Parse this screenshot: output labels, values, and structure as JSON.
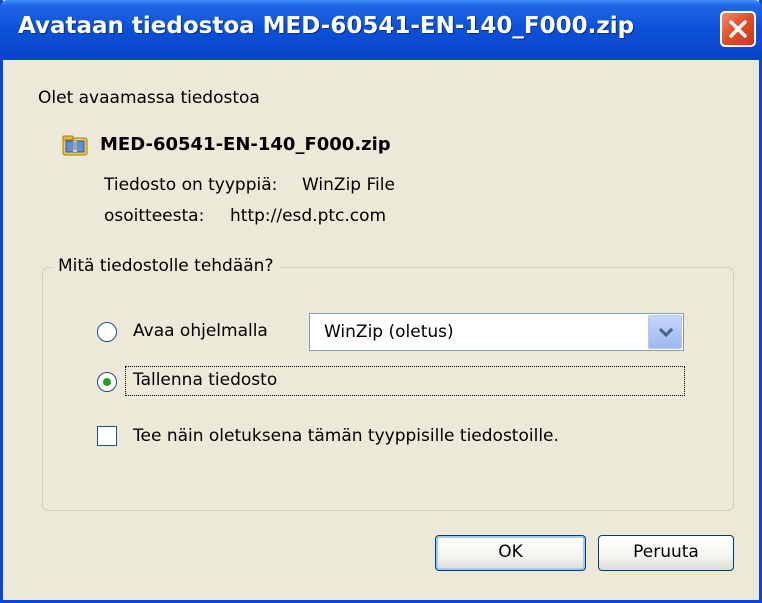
{
  "window": {
    "title": "Avataan tiedostoa MED-60541-EN-140_F000.zip",
    "close_icon": "close-icon"
  },
  "intro_text": "Olet avaamassa tiedostoa",
  "file": {
    "icon": "zip-file-icon",
    "name": "MED-60541-EN-140_F000.zip",
    "type_label": "Tiedosto on tyyppiä:",
    "type_value": "WinZip File",
    "from_label": "osoitteesta:",
    "from_value": "http://esd.ptc.com"
  },
  "action_group": {
    "legend": "Mitä tiedostolle tehdään?",
    "open_with_label": "Avaa ohjelmalla",
    "open_with_selected": false,
    "open_with_app": "WinZip (oletus)",
    "save_label": "Tallenna tiedosto",
    "save_selected": true,
    "remember_label": "Tee näin oletuksena tämän tyyppisille tiedostoille.",
    "remember_checked": false
  },
  "buttons": {
    "ok_label": "OK",
    "cancel_label": "Peruuta"
  },
  "colors": {
    "titlebar": "#0a4ad0",
    "dialog_bg": "#ece9d8",
    "close_button": "#e0502a",
    "radio_selected": "#21a121"
  }
}
